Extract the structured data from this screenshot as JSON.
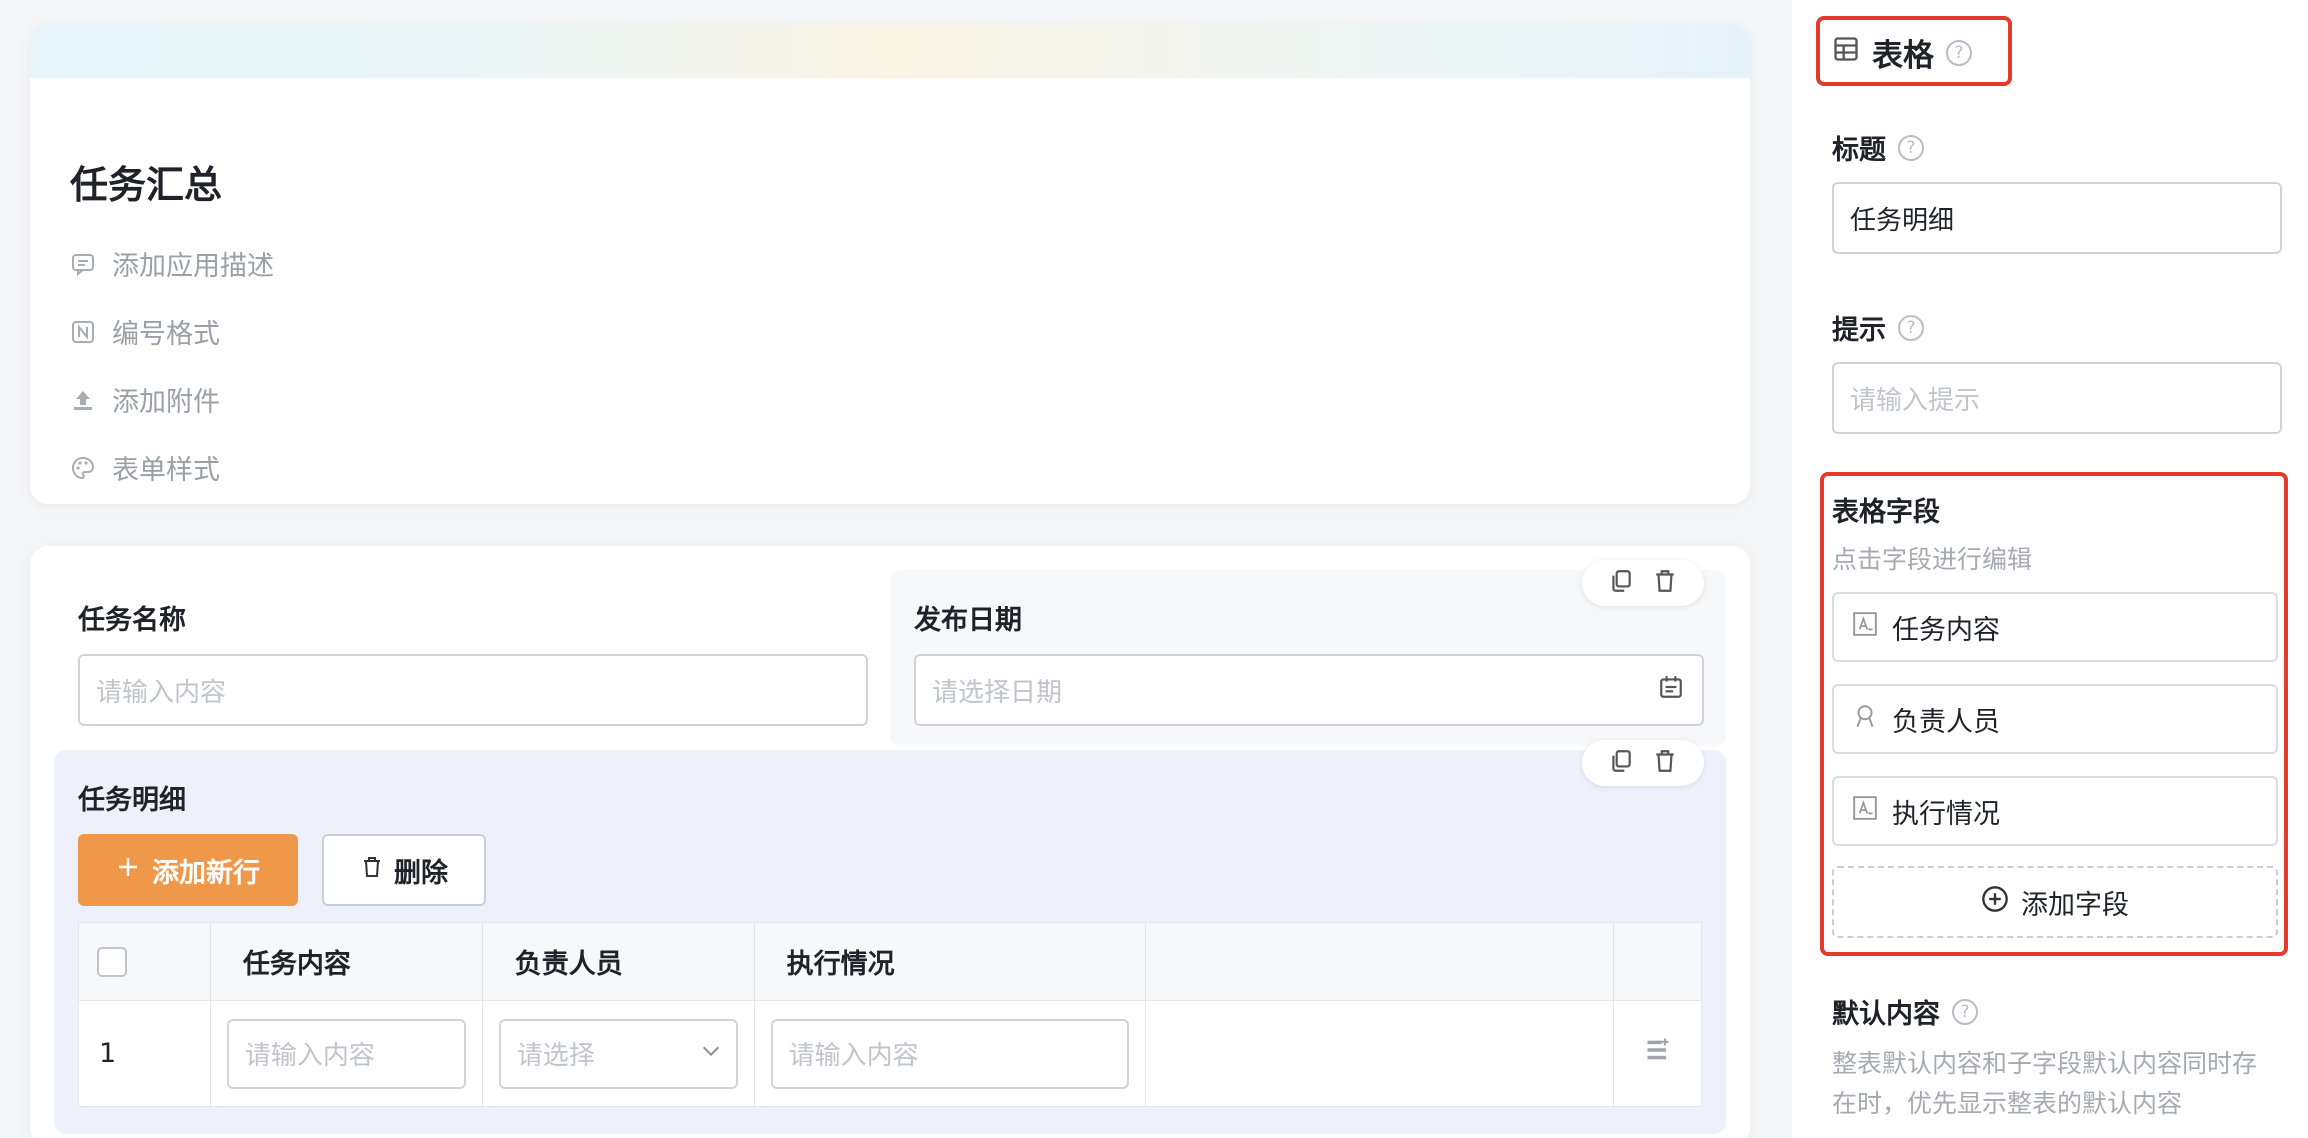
{
  "header_card": {
    "title": "任务汇总",
    "actions": [
      {
        "icon": "comment-icon",
        "label": "添加应用描述"
      },
      {
        "icon": "numbering-icon",
        "label": "编号格式"
      },
      {
        "icon": "upload-icon",
        "label": "添加附件"
      },
      {
        "icon": "palette-icon",
        "label": "表单样式"
      }
    ]
  },
  "form": {
    "task_name": {
      "label": "任务名称",
      "placeholder": "请输入内容"
    },
    "publish_date": {
      "label": "发布日期",
      "placeholder": "请选择日期"
    },
    "detail_table": {
      "label": "任务明细",
      "add_row_label": "添加新行",
      "delete_label": "删除",
      "columns": [
        "任务内容",
        "负责人员",
        "执行情况"
      ],
      "rows": [
        {
          "index": "1",
          "content_placeholder": "请输入内容",
          "person_placeholder": "请选择",
          "status_placeholder": "请输入内容"
        }
      ]
    }
  },
  "panel": {
    "header": "表格",
    "title_label": "标题",
    "title_value": "任务明细",
    "hint_label": "提示",
    "hint_placeholder": "请输入提示",
    "fields_label": "表格字段",
    "fields_hint": "点击字段进行编辑",
    "fields": [
      {
        "icon": "text-field-icon",
        "label": "任务内容"
      },
      {
        "icon": "person-icon",
        "label": "负责人员"
      },
      {
        "icon": "text-field-icon",
        "label": "执行情况"
      }
    ],
    "add_field_label": "添加字段",
    "default_label": "默认内容",
    "default_desc_line1": "整表默认内容和子字段默认内容同时存",
    "default_desc_line2": "在时，优先显示整表的默认内容"
  },
  "colors": {
    "accent_orange": "#f0984a",
    "highlight_red": "#e5392b",
    "table_bg": "#eef1fb"
  }
}
